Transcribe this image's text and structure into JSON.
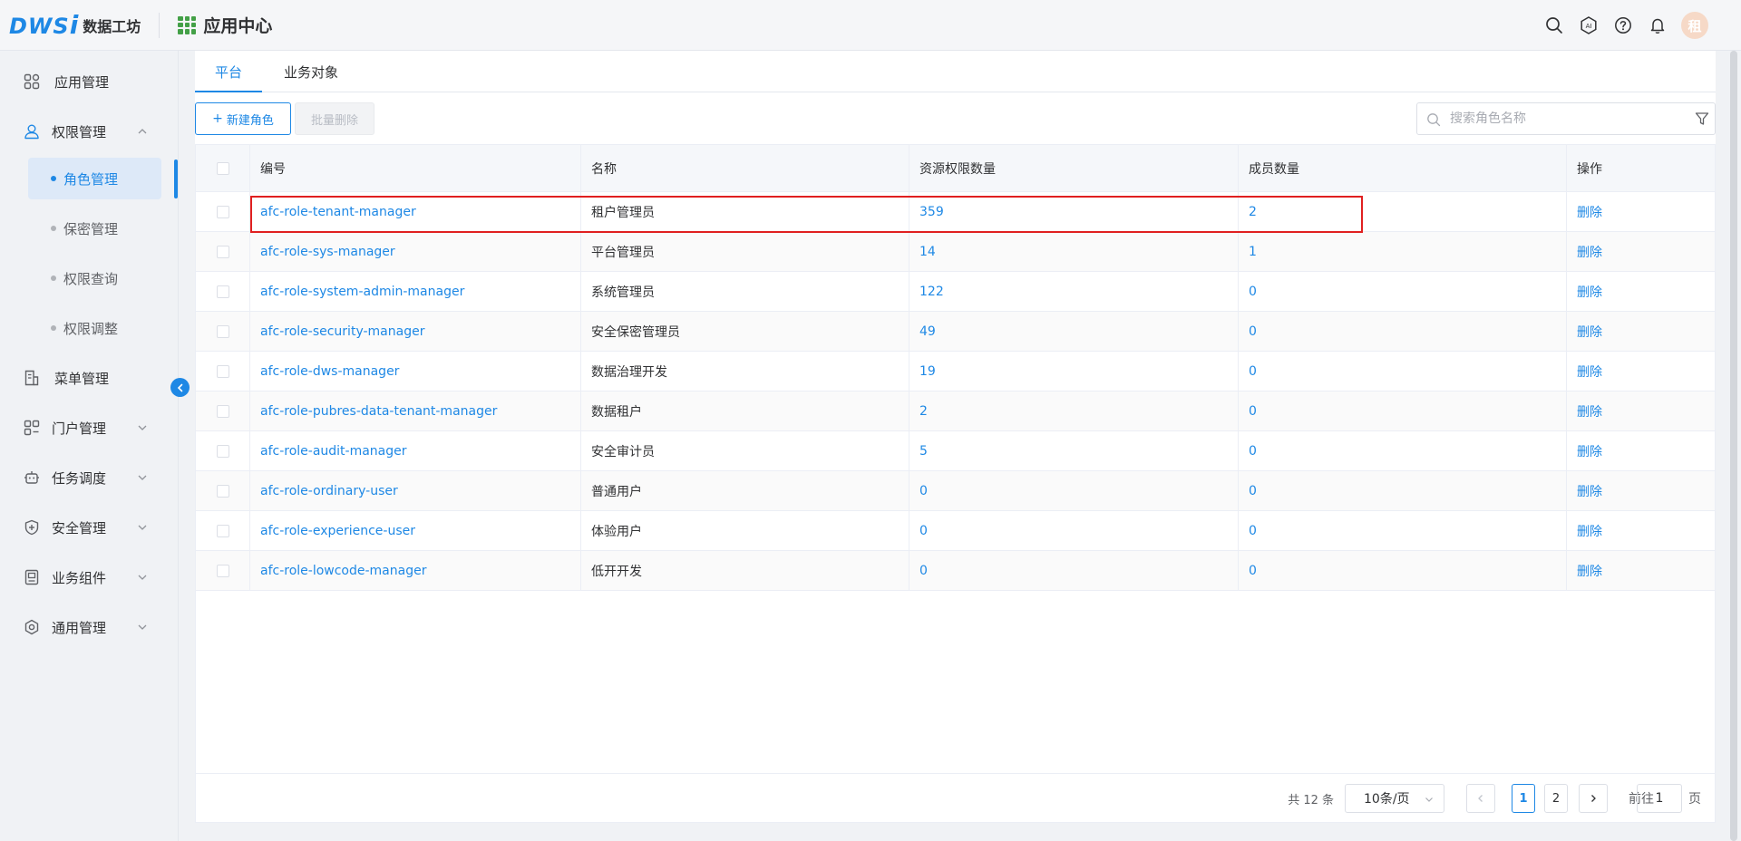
{
  "header": {
    "logo_mark": "DWS",
    "logo_mark_i": "i",
    "logo_text": "数据工坊",
    "app_title": "应用中心",
    "avatar_text": "租"
  },
  "sidebar": {
    "items": [
      {
        "label": "应用管理",
        "icon": "apps-icon"
      },
      {
        "label": "权限管理",
        "icon": "user-shield-icon"
      },
      {
        "label": "菜单管理",
        "icon": "menu-doc-icon"
      },
      {
        "label": "门户管理",
        "icon": "portal-icon"
      },
      {
        "label": "任务调度",
        "icon": "robot-icon"
      },
      {
        "label": "安全管理",
        "icon": "shield-icon"
      },
      {
        "label": "业务组件",
        "icon": "component-icon"
      },
      {
        "label": "通用管理",
        "icon": "settings-icon"
      }
    ],
    "sub_items": [
      {
        "label": "角色管理",
        "active": true
      },
      {
        "label": "保密管理",
        "active": false
      },
      {
        "label": "权限查询",
        "active": false
      },
      {
        "label": "权限调整",
        "active": false
      }
    ]
  },
  "tabs": [
    {
      "label": "平台",
      "active": true
    },
    {
      "label": "业务对象",
      "active": false
    }
  ],
  "toolbar": {
    "new_label": "新建角色",
    "delete_label": "批量删除"
  },
  "search": {
    "placeholder": "搜索角色名称"
  },
  "table": {
    "columns": [
      "编号",
      "名称",
      "资源权限数量",
      "成员数量",
      "操作"
    ],
    "action_label": "删除",
    "rows": [
      {
        "code": "afc-role-tenant-manager",
        "name": "租户管理员",
        "resources": "359",
        "members": "2"
      },
      {
        "code": "afc-role-sys-manager",
        "name": "平台管理员",
        "resources": "14",
        "members": "1"
      },
      {
        "code": "afc-role-system-admin-manager",
        "name": "系统管理员",
        "resources": "122",
        "members": "0"
      },
      {
        "code": "afc-role-security-manager",
        "name": "安全保密管理员",
        "resources": "49",
        "members": "0"
      },
      {
        "code": "afc-role-dws-manager",
        "name": "数据治理开发",
        "resources": "19",
        "members": "0"
      },
      {
        "code": "afc-role-pubres-data-tenant-manager",
        "name": "数据租户",
        "resources": "2",
        "members": "0"
      },
      {
        "code": "afc-role-audit-manager",
        "name": "安全审计员",
        "resources": "5",
        "members": "0"
      },
      {
        "code": "afc-role-ordinary-user",
        "name": "普通用户",
        "resources": "0",
        "members": "0"
      },
      {
        "code": "afc-role-experience-user",
        "name": "体验用户",
        "resources": "0",
        "members": "0"
      },
      {
        "code": "afc-role-lowcode-manager",
        "name": "低开开发",
        "resources": "0",
        "members": "0"
      }
    ]
  },
  "pager": {
    "total": "共 12 条",
    "page_size": "10条/页",
    "pages": [
      "1",
      "2"
    ],
    "current_page": "1",
    "jump_label": "前往",
    "jump_value": "1",
    "jump_unit": "页"
  },
  "colors": {
    "accent": "#1e88e5",
    "highlight": "#e02020",
    "logo_green": "#43a047"
  }
}
